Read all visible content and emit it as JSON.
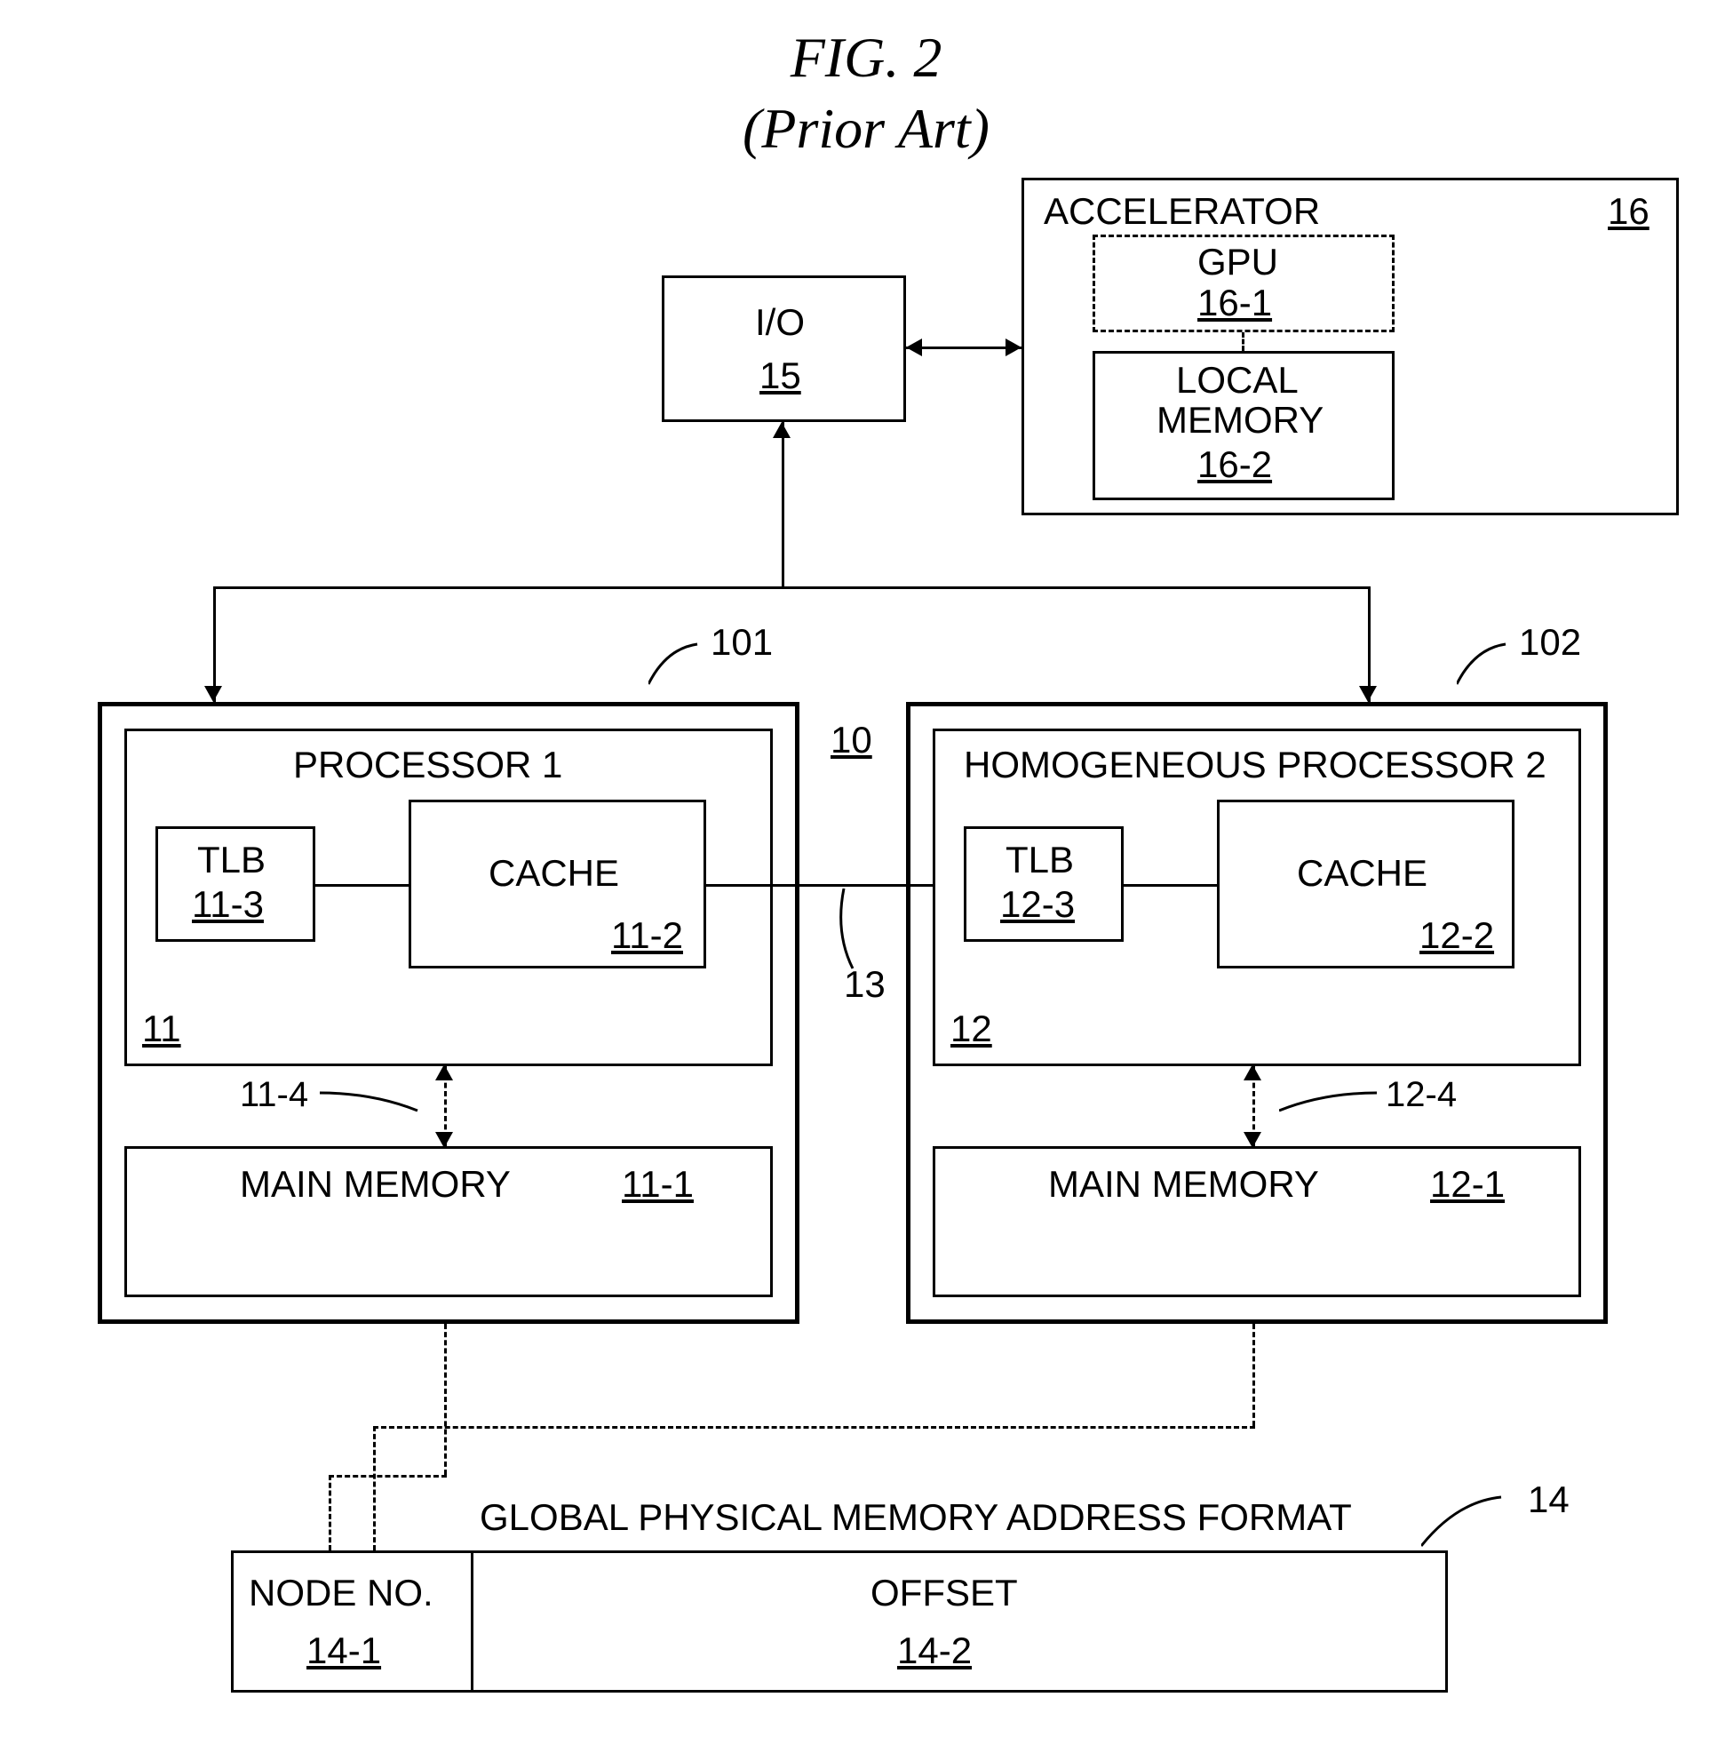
{
  "figure": {
    "title": "FIG. 2",
    "subtitle": "(Prior Art)"
  },
  "accelerator": {
    "title": "ACCELERATOR",
    "ref": "16",
    "gpu": {
      "label": "GPU",
      "ref": "16-1"
    },
    "localmem": {
      "label1": "LOCAL",
      "label2": "MEMORY",
      "ref": "16-2"
    }
  },
  "io": {
    "label": "I/O",
    "ref": "15"
  },
  "node1": {
    "proc": {
      "title": "PROCESSOR 1",
      "ref": "11"
    },
    "tlb": {
      "label": "TLB",
      "ref": "11-3"
    },
    "cache": {
      "label": "CACHE",
      "ref": "11-2"
    },
    "mem": {
      "label": "MAIN MEMORY",
      "ref": "11-1"
    },
    "link_ref": "11-4",
    "outer_ref": "101"
  },
  "node2": {
    "proc": {
      "title": "HOMOGENEOUS PROCESSOR 2",
      "ref": "12"
    },
    "tlb": {
      "label": "TLB",
      "ref": "12-3"
    },
    "cache": {
      "label": "CACHE",
      "ref": "12-2"
    },
    "mem": {
      "label": "MAIN MEMORY",
      "ref": "12-1"
    },
    "link_ref": "12-4",
    "outer_ref": "102"
  },
  "bus": {
    "ref": "13",
    "mid_ref": "10"
  },
  "addr": {
    "title": "GLOBAL PHYSICAL MEMORY ADDRESS FORMAT",
    "ref": "14",
    "node": {
      "label": "NODE NO.",
      "ref": "14-1"
    },
    "offset": {
      "label": "OFFSET",
      "ref": "14-2"
    }
  }
}
